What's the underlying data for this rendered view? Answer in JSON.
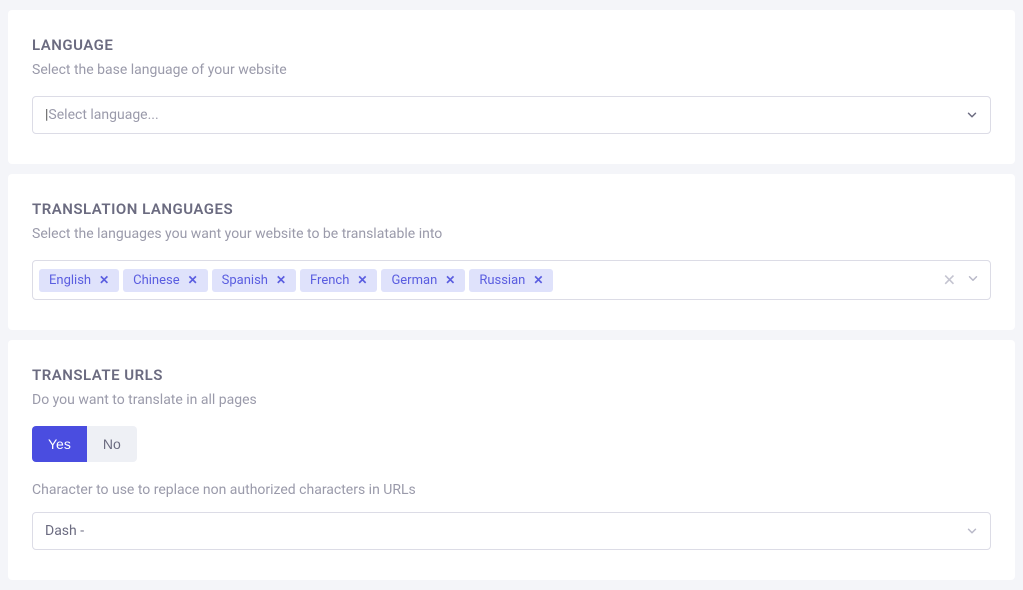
{
  "language": {
    "title": "LANGUAGE",
    "desc": "Select the base language of your website",
    "placeholder": "Select language..."
  },
  "translation": {
    "title": "TRANSLATION LANGUAGES",
    "desc": "Select the languages you want your website to be translatable into",
    "tags": [
      "English",
      "Chinese",
      "Spanish",
      "French",
      "German",
      "Russian"
    ]
  },
  "urls": {
    "title": "TRANSLATE URLS",
    "desc": "Do you want to translate in all pages",
    "yes": "Yes",
    "no": "No",
    "char_label": "Character to use to replace non authorized characters in URLs",
    "char_value": "Dash -"
  }
}
